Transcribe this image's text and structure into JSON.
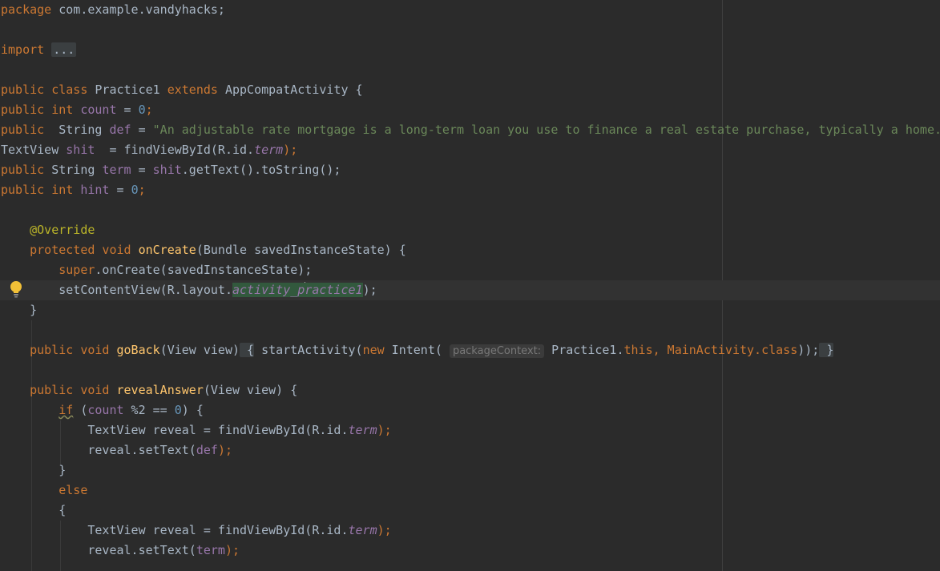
{
  "editor": {
    "language": "java",
    "colors": {
      "background": "#2b2b2b",
      "current_line": "#323232",
      "keyword": "#cc7832",
      "string": "#6a8759",
      "number": "#6897bb",
      "field": "#9876aa",
      "method": "#ffc66d",
      "annotation": "#bbb529",
      "text": "#a9b7c6"
    },
    "gutter_icon": "lightbulb-icon",
    "lines": [
      {
        "kw1": "package",
        "rest": " com.example.vandyhacks;"
      },
      {},
      {
        "kw1": "import",
        "fold": "..."
      },
      {},
      {
        "kw1": "public class",
        "name": " Practice1 ",
        "kw2": "extends",
        "rest": " AppCompatActivity {"
      },
      {
        "kw1": "public int",
        "field": " count",
        "eq": " = ",
        "num": "0",
        "end": ";"
      },
      {
        "kw1": "public",
        "type": "  String ",
        "field": "def",
        "eq": " = ",
        "str": "\"An adjustable rate mortgage is a long-term loan you use to finance a real estate purchase, typically a home."
      },
      {
        "type": "TextView ",
        "field": "shit",
        "mid": "  = findViewById(R.id.",
        "ifield": "term",
        "end": ");"
      },
      {
        "kw1": "public",
        "type": " String ",
        "field": "term",
        "eq": " = ",
        "field2": "shit",
        "end": ".getText().toString();"
      },
      {
        "kw1": "public int",
        "field": " hint",
        "eq": " = ",
        "num": "0",
        "end": ";"
      },
      {},
      {
        "ann": "@Override"
      },
      {
        "kw1": "protected void",
        "fn": " onCreate",
        "rest": "(Bundle savedInstanceState) {"
      },
      {
        "kw1": "super",
        "rest": ".onCreate(savedInstanceState);"
      },
      {
        "pre": "setContentView(R.layout.",
        "hl1": "activity_p",
        "hl2": "ractice1",
        "end": ");"
      },
      {
        "brace": "}"
      },
      {},
      {
        "kw1": "public void",
        "fn": " goBack",
        "rest": "(View view)",
        "ob": " {",
        "pre": " startActivity(",
        "kw2": "new",
        "mid": " Intent( ",
        "hint": "packageContext:",
        "cls": " Practice1.",
        "kw3": "this",
        "comma": ", MainActivity.",
        "kw4": "class",
        "end": "));",
        "cb": " }"
      },
      {},
      {
        "kw1": "public void",
        "fn": " revealAnswer",
        "rest": "(View view) {"
      },
      {
        "kw1": "if",
        "pre": " (",
        "field": "count",
        "mid": " %2 == ",
        "num": "0",
        "end": ") {"
      },
      {
        "pre": "TextView reveal = findViewById(R.id.",
        "ifield": "term",
        "end": ");"
      },
      {
        "pre": "reveal.setText(",
        "field": "def",
        "end": ");"
      },
      {
        "brace": "}"
      },
      {
        "kw1": "else"
      },
      {
        "brace": "{"
      },
      {
        "pre": "TextView reveal = findViewById(R.id.",
        "ifield": "term",
        "end": ");"
      },
      {
        "pre": "reveal.setText(",
        "field": "term",
        "end": ");"
      }
    ]
  }
}
